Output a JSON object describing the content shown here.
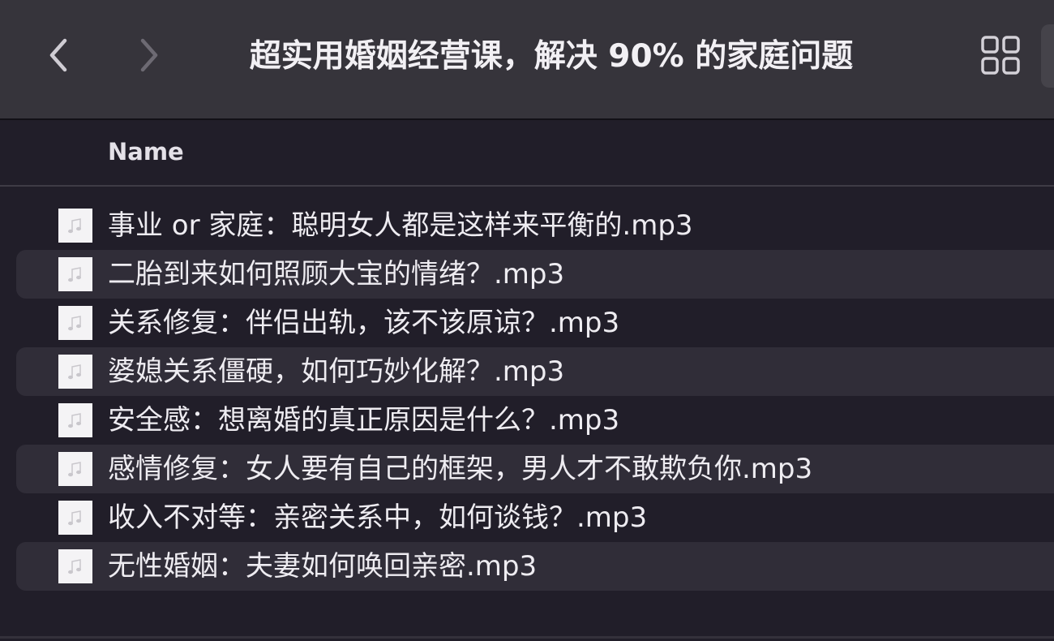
{
  "window": {
    "title": "超实用婚姻经营课，解决 90% 的家庭问题"
  },
  "toolbar": {
    "back_icon": "chevron-left-icon",
    "forward_icon": "chevron-right-icon",
    "view_icon": "grid-view-icon"
  },
  "columns": {
    "name": "Name"
  },
  "files": [
    {
      "name": "事业 or 家庭：聪明女人都是这样来平衡的.mp3",
      "icon": "audio-file-icon"
    },
    {
      "name": "二胎到来如何照顾大宝的情绪？.mp3",
      "icon": "audio-file-icon"
    },
    {
      "name": "关系修复：伴侣出轨，该不该原谅？.mp3",
      "icon": "audio-file-icon"
    },
    {
      "name": "婆媳关系僵硬，如何巧妙化解？.mp3",
      "icon": "audio-file-icon"
    },
    {
      "name": "安全感：想离婚的真正原因是什么？.mp3",
      "icon": "audio-file-icon"
    },
    {
      "name": "感情修复：女人要有自己的框架，男人才不敢欺负你.mp3",
      "icon": "audio-file-icon"
    },
    {
      "name": "收入不对等：亲密关系中，如何谈钱？.mp3",
      "icon": "audio-file-icon"
    },
    {
      "name": "无性婚姻：夫妻如何唤回亲密.mp3",
      "icon": "audio-file-icon"
    }
  ]
}
